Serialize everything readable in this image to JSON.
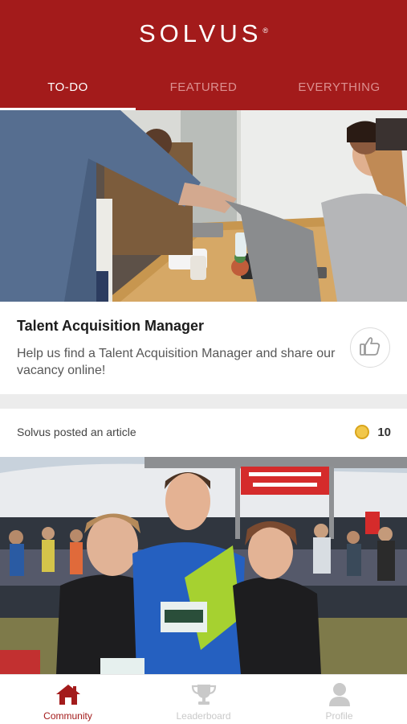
{
  "app": {
    "logo_text": "SOLVUS",
    "logo_mark": "®"
  },
  "tabs": [
    {
      "label": "TO-DO",
      "active": true
    },
    {
      "label": "FEATURED",
      "active": false
    },
    {
      "label": "EVERYTHING",
      "active": false
    }
  ],
  "feed": {
    "task_card": {
      "title": "Talent Acquisition Manager",
      "description": "Help us find a Talent Acquisition Manager and share our vacancy online!",
      "image": "handshake-meeting-photo",
      "action_icon": "thumbs-up-icon"
    },
    "article_card": {
      "posted_text": "Solvus posted an article",
      "points": "10",
      "points_icon": "coin-icon",
      "image": "marathon-runners-photo"
    }
  },
  "bottom_nav": [
    {
      "label": "Community",
      "icon": "home-icon",
      "active": true
    },
    {
      "label": "Leaderboard",
      "icon": "trophy-icon",
      "active": false
    },
    {
      "label": "Profile",
      "icon": "person-icon",
      "active": false
    }
  ],
  "colors": {
    "brand": "#a31b1b",
    "inactive_tab": "#dc9090",
    "inactive_nav": "#c9c9c9",
    "coin": "#f1c74a"
  }
}
